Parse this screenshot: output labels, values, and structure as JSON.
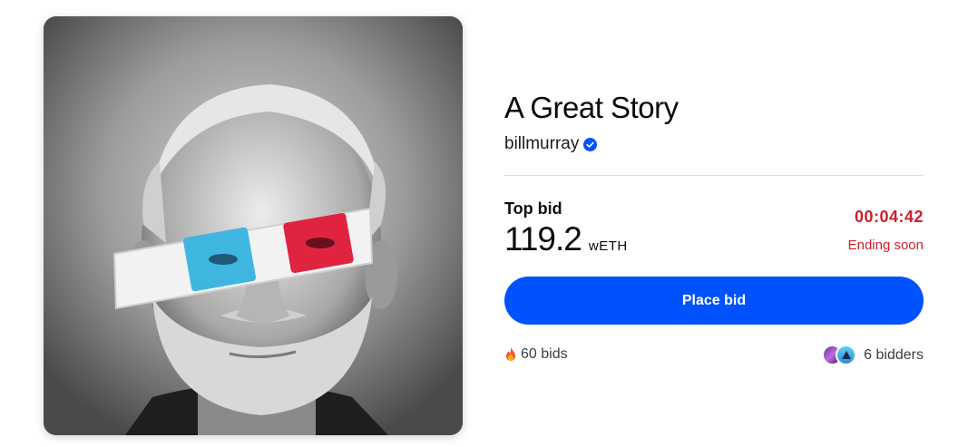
{
  "artwork": {
    "subject_icon": "portrait-3d-glasses",
    "colors": {
      "lens_left": "#3fb6e0",
      "lens_right": "#e0233f"
    }
  },
  "title": "A Great Story",
  "creator": {
    "name": "billmurray",
    "verified_icon": "verified-badge-icon"
  },
  "bid": {
    "label": "Top bid",
    "amount": "119.2",
    "unit": "wETH"
  },
  "countdown": {
    "time": "00:04:42",
    "status": "Ending soon"
  },
  "actions": {
    "place_bid_label": "Place bid"
  },
  "stats": {
    "bids_icon": "fire-icon",
    "bids_label": "60 bids",
    "bidders_label": "6 bidders"
  },
  "colors": {
    "accent": "#0052ff",
    "alert": "#cf202f"
  }
}
